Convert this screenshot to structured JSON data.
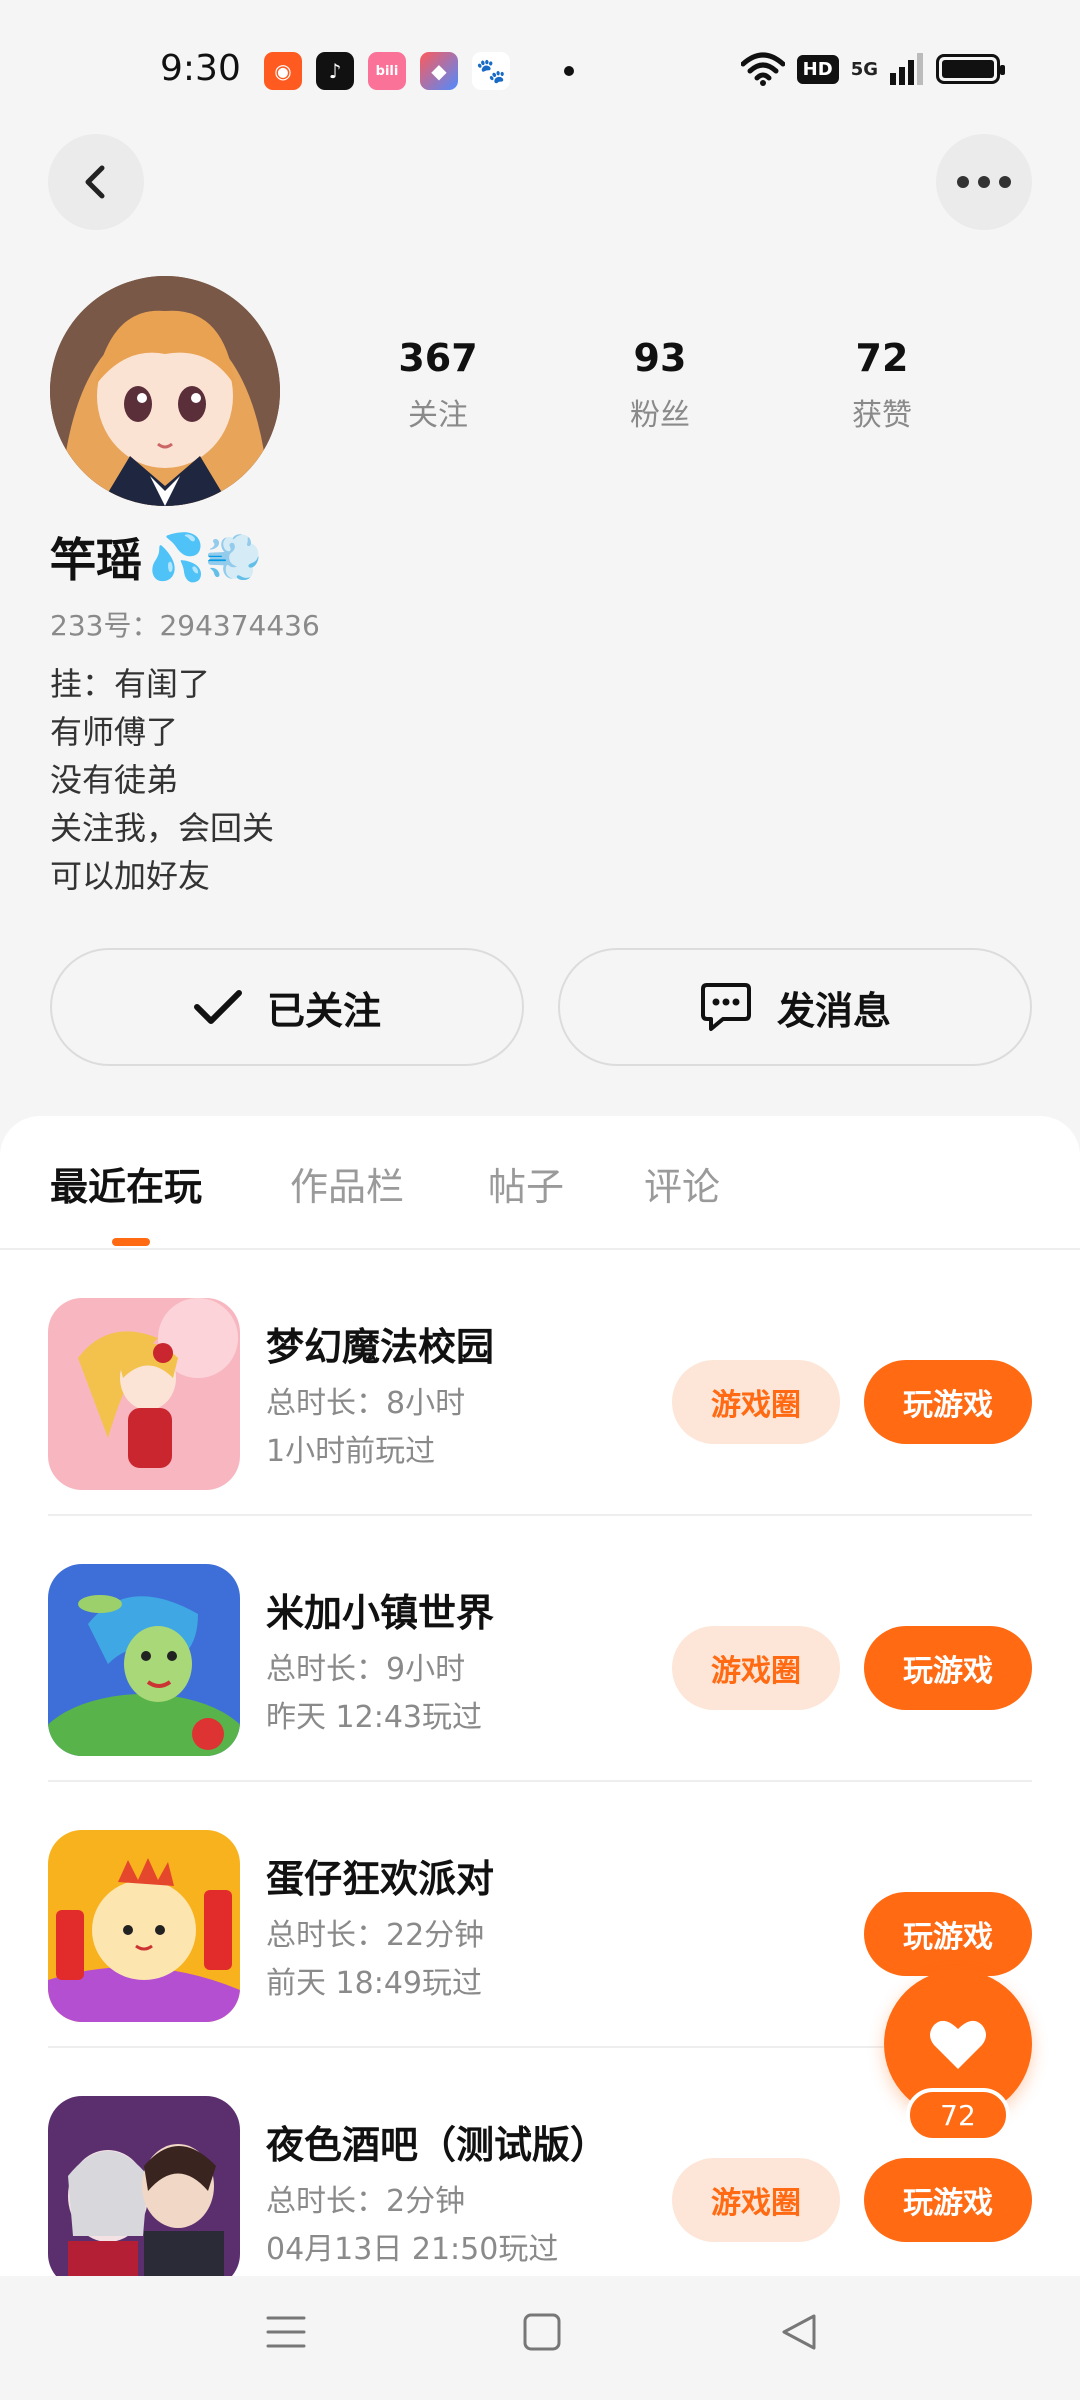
{
  "status_bar": {
    "time": "9:30",
    "hd": "HD",
    "network": "5G"
  },
  "profile": {
    "stats": [
      {
        "value": "367",
        "label": "关注"
      },
      {
        "value": "93",
        "label": "粉丝"
      },
      {
        "value": "72",
        "label": "获赞"
      }
    ],
    "username": "竿瑶",
    "emoji": "💦💨",
    "id_text": "233号：294374436",
    "bio": [
      "挂：有闺了",
      "有师傅了",
      "没有徒弟",
      "关注我，会回关",
      "可以加好友"
    ],
    "follow_label": "已关注",
    "message_label": "发消息"
  },
  "tabs": [
    {
      "label": "最近在玩",
      "active": true
    },
    {
      "label": "作品栏",
      "active": false
    },
    {
      "label": "帖子",
      "active": false
    },
    {
      "label": "评论",
      "active": false
    }
  ],
  "games": [
    {
      "title": "梦幻魔法校园",
      "duration": "总时长：8小时",
      "last_played": "1小时前玩过",
      "circle_label": "游戏圈",
      "play_label": "玩游戏",
      "has_circle": true
    },
    {
      "title": "米加小镇世界",
      "duration": "总时长：9小时",
      "last_played": "昨天 12:43玩过",
      "circle_label": "游戏圈",
      "play_label": "玩游戏",
      "has_circle": true
    },
    {
      "title": "蛋仔狂欢派对",
      "duration": "总时长：22分钟",
      "last_played": "前天 18:49玩过",
      "circle_label": "",
      "play_label": "玩游戏",
      "has_circle": false
    },
    {
      "title": "夜色酒吧（测试版）",
      "duration": "总时长：2分钟",
      "last_played": "04月13日 21:50玩过",
      "circle_label": "游戏圈",
      "play_label": "玩游戏",
      "has_circle": true
    }
  ],
  "like_fab": {
    "count": "72"
  },
  "colors": {
    "accent": "#ff6a13",
    "accent_light": "#fde6d7",
    "background": "#f5f5f5"
  }
}
